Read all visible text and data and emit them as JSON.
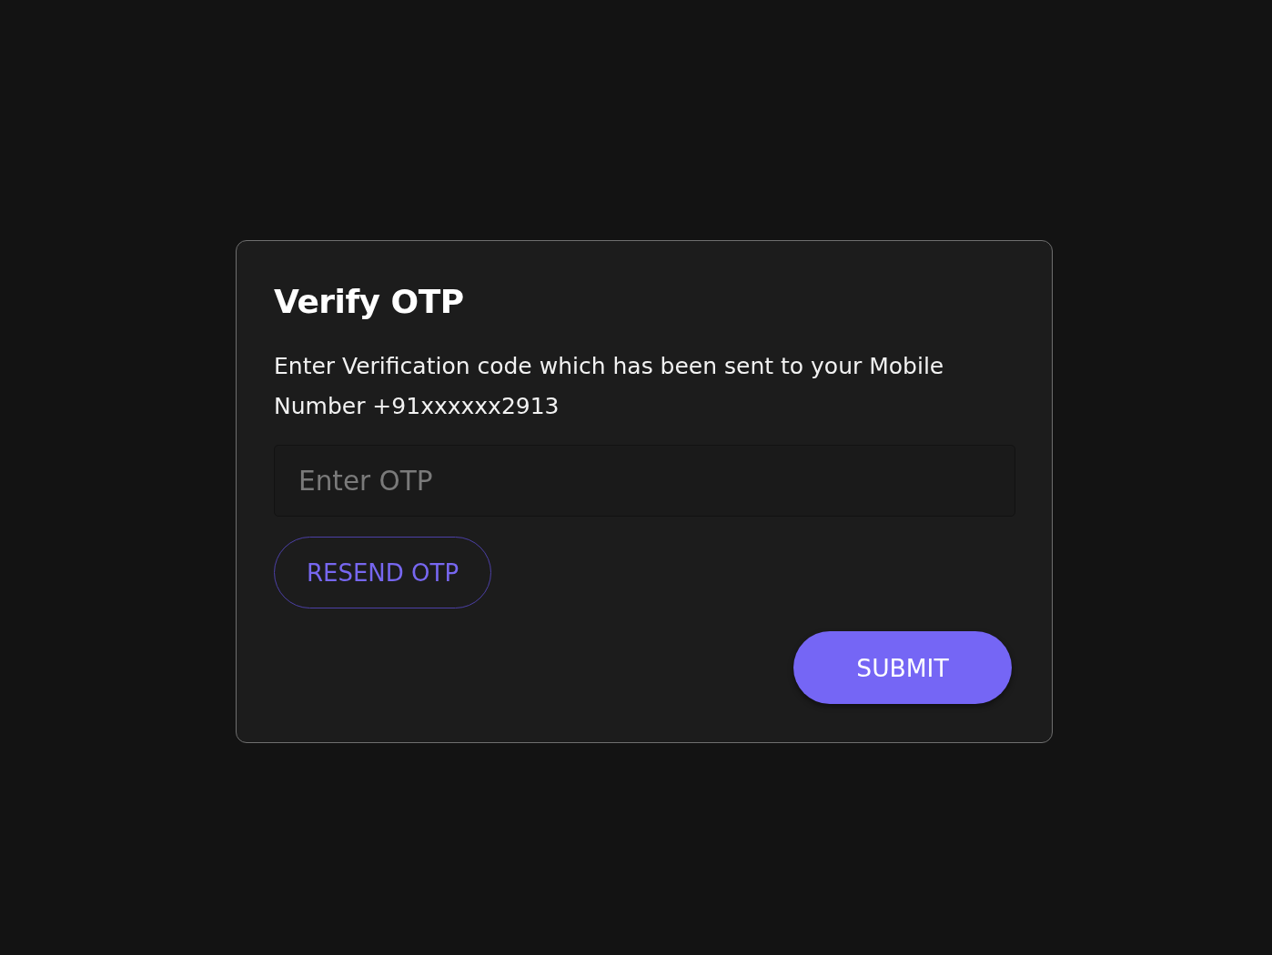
{
  "dialog": {
    "title": "Verify OTP",
    "message": "Enter Verification code which has been sent to your Mobile Number +91xxxxxx2913",
    "otp_field": {
      "placeholder": "Enter OTP"
    },
    "resend_button": "RESEND OTP",
    "submit_button": "SUBMIT"
  }
}
